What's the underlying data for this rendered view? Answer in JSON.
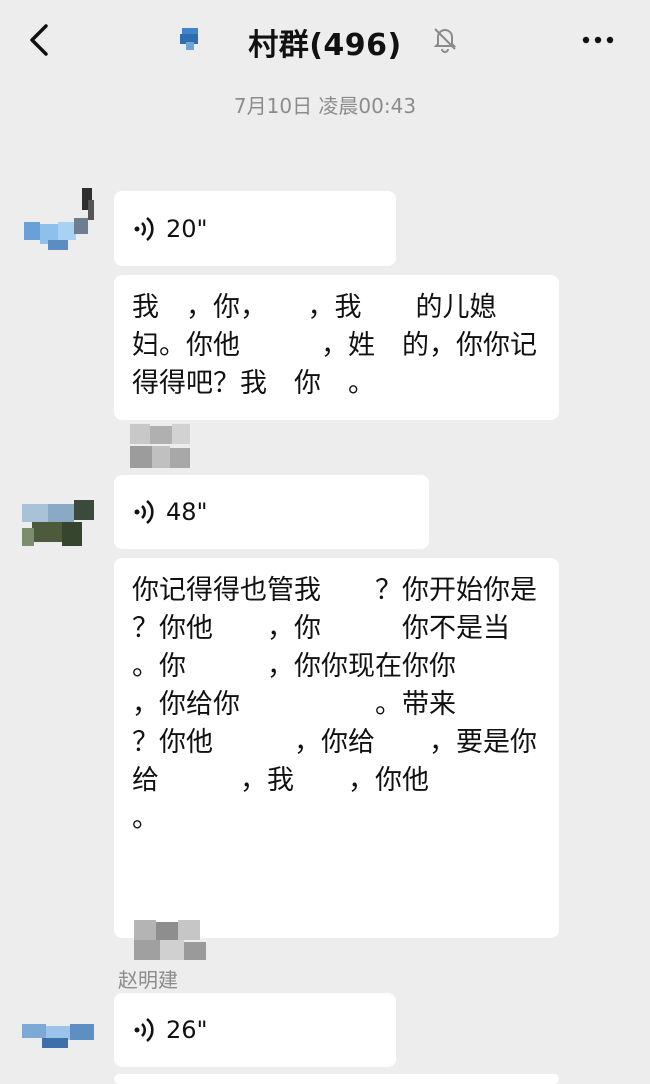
{
  "header": {
    "title": "村群(496)",
    "back_icon": "chevron-left-icon",
    "group_icon": "group-avatar-icon",
    "mute_icon": "bell-off-icon",
    "more_icon": "more-dots-icon"
  },
  "timestamp": "7月10日 凌晨00:43",
  "messages": [
    {
      "type": "voice",
      "duration": "20\""
    },
    {
      "type": "text",
      "text": "我　，你，　　，我　　的儿媳妇。你他　　　，姓　的，你你记得得吧？我　你　。"
    },
    {
      "type": "voice",
      "duration": "48\""
    },
    {
      "type": "text",
      "text": "你记得得也管我　　？你开始你是　　？你他　　，你　　　你不是当　　。你　　　，你你现在你你　　　　，你给你　　　　　。带来　　　　　？你他　　　，你给　　，要是你给　　　，我　　，你他　　　　　。　　　"
    },
    {
      "type": "voice",
      "duration": "26\"",
      "sender": "赵明建"
    }
  ],
  "colors": {
    "background": "#ededed",
    "bubble": "#ffffff",
    "timestamp": "#8c8c8c"
  }
}
